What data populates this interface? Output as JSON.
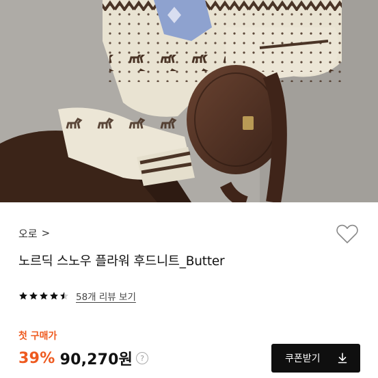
{
  "product": {
    "brand": "오로",
    "brand_chevron": ">",
    "title": "노르딕 스노우 플라워 후드니트_Butter",
    "hero_image": "model-wearing-nordic-knit-hoodie-with-round-leather-bag",
    "wishlist_icon": "heart-outline-icon"
  },
  "rating": {
    "stars": 4.5,
    "max_stars": 5,
    "review_link": "58개 리뷰 보기"
  },
  "pricing": {
    "first_purchase_label": "첫 구매가",
    "discount": "39%",
    "price": "90,270원",
    "help_icon": "?",
    "accent_color": "#ee5a1f"
  },
  "coupon": {
    "label": "쿠폰받기",
    "icon": "download-icon",
    "bg_color": "#0f0f0f"
  }
}
